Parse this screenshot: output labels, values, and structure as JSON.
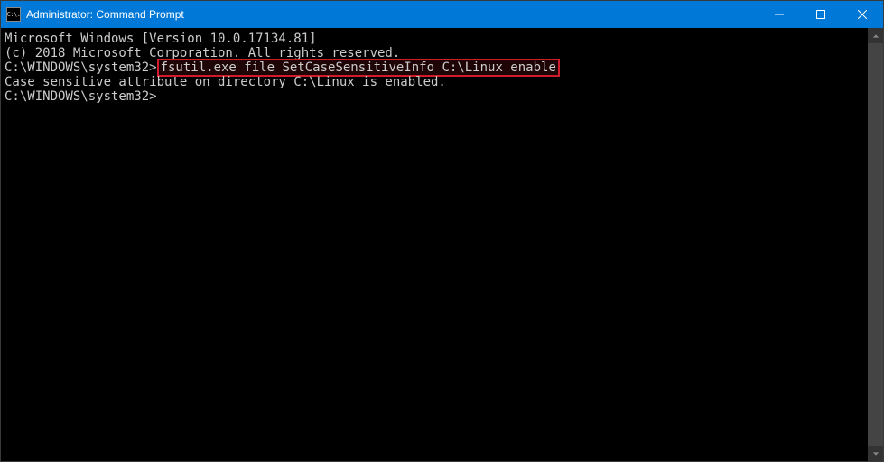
{
  "titlebar": {
    "icon_label": "C:\\.",
    "title": "Administrator: Command Prompt",
    "minimize_label": "Minimize",
    "maximize_label": "Maximize",
    "close_label": "Close"
  },
  "console": {
    "line1": "Microsoft Windows [Version 10.0.17134.81]",
    "line2": "(c) 2018 Microsoft Corporation. All rights reserved.",
    "blank1": "",
    "prompt1": "C:\\WINDOWS\\system32>",
    "command_highlighted": "fsutil.exe file SetCaseSensitiveInfo C:\\Linux enable",
    "output1": "Case sensitive attribute on directory C:\\Linux is enabled.",
    "blank2": "",
    "prompt2": "C:\\WINDOWS\\system32>"
  },
  "colors": {
    "titlebar_bg": "#0078d7",
    "console_bg": "#000000",
    "text": "#cccccc",
    "highlight_border": "#d01c2a"
  }
}
